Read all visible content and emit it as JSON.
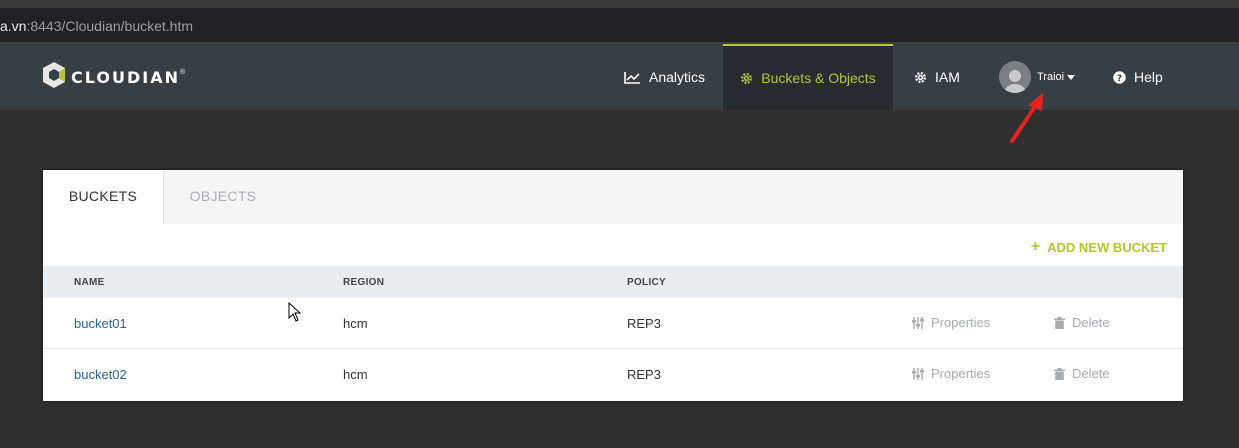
{
  "browser": {
    "url_host": "a.vn",
    "url_path": ":8443/Cloudian/bucket.htm"
  },
  "brand": {
    "logo_text": "CLOUDIAN",
    "accent_color": "#b5c72a",
    "nav_bg": "#363e46"
  },
  "nav": {
    "analytics": "Analytics",
    "buckets_objects": "Buckets & Objects",
    "iam": "IAM",
    "user": "Traioi",
    "help": "Help"
  },
  "tabs": {
    "buckets": "BUCKETS",
    "objects": "OBJECTS"
  },
  "actions": {
    "add_new_bucket": "ADD NEW BUCKET"
  },
  "table": {
    "headers": {
      "name": "NAME",
      "region": "REGION",
      "policy": "POLICY"
    },
    "rows": [
      {
        "name": "bucket01",
        "region": "hcm",
        "policy": "REP3",
        "properties": "Properties",
        "delete": "Delete"
      },
      {
        "name": "bucket02",
        "region": "hcm",
        "policy": "REP3",
        "properties": "Properties",
        "delete": "Delete"
      }
    ]
  }
}
